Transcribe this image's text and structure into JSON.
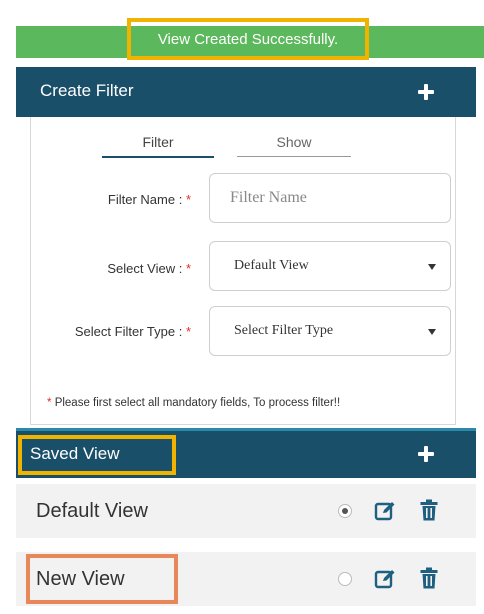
{
  "toast": {
    "message": "View Created Successfully."
  },
  "create_filter": {
    "title": "Create Filter",
    "tabs": [
      {
        "label": "Filter",
        "active": true
      },
      {
        "label": "Show",
        "active": false
      }
    ],
    "fields": {
      "filter_name": {
        "label": "Filter Name :",
        "required_mark": "*",
        "placeholder": "Filter Name",
        "value": ""
      },
      "select_view": {
        "label": "Select View :",
        "required_mark": "*",
        "selected": "Default View"
      },
      "select_filter_type": {
        "label": "Select Filter Type :",
        "required_mark": "*",
        "selected": "Select Filter Type"
      }
    },
    "note": {
      "mark": "*",
      "text": "Please first select all mandatory fields, To process filter!!"
    },
    "icon": "plus-icon"
  },
  "saved_view": {
    "title": "Saved View",
    "icon": "plus-icon",
    "items": [
      {
        "name": "Default View",
        "selected": true
      },
      {
        "name": "New View",
        "selected": false
      }
    ]
  },
  "colors": {
    "toast_bg": "#5cb85c",
    "header_bg": "#1a4f69",
    "highlight_yellow": "#f0b400",
    "highlight_orange": "#e8885a",
    "icon_blue": "#1f5f80",
    "required_red": "#e52b2b"
  }
}
